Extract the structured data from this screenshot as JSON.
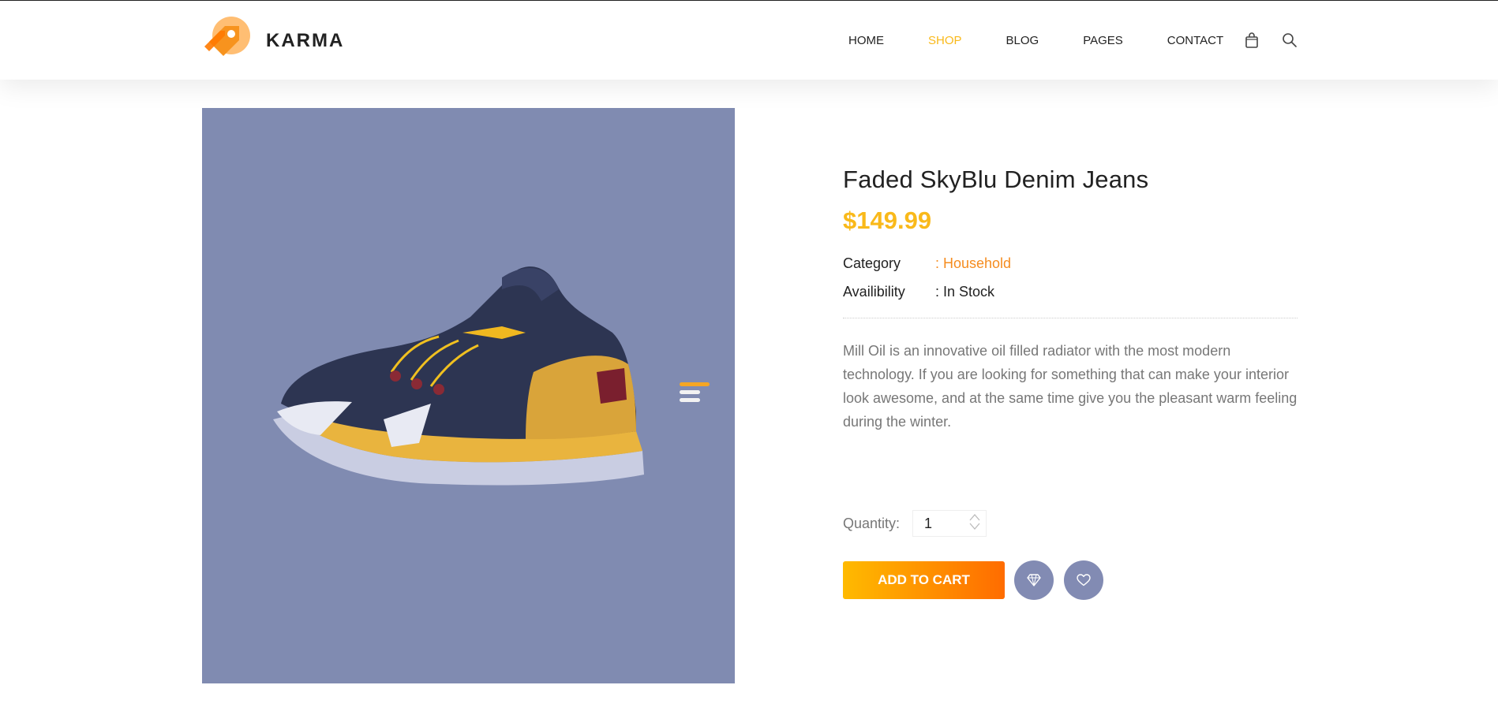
{
  "brand": {
    "name": "KARMA",
    "primary_color": "#f9b91a",
    "accent_orange": "#f58c1f"
  },
  "nav": {
    "items": [
      {
        "label": "HOME",
        "active": false
      },
      {
        "label": "SHOP",
        "active": true
      },
      {
        "label": "BLOG",
        "active": false
      },
      {
        "label": "PAGES",
        "active": false
      },
      {
        "label": "CONTACT",
        "active": false
      }
    ],
    "icons": [
      "shopping-bag-icon",
      "search-icon"
    ]
  },
  "gallery": {
    "background": "#808bb1",
    "image": "basketball-shoe"
  },
  "product": {
    "title": "Faded SkyBlu Denim Jeans",
    "price": "$149.99",
    "category_label": "Category",
    "category_value": ": Household",
    "availability_label": "Availibility",
    "availability_value": ": In Stock",
    "description": "Mill Oil is an innovative oil filled radiator with the most modern technology. If you are looking for something that can make your interior look awesome, and at the same time give you the pleasant warm feeling during the winter."
  },
  "purchase": {
    "quantity_label": "Quantity:",
    "quantity_value": "1",
    "add_to_cart_label": "ADD TO CART",
    "icons": [
      "diamond-icon",
      "heart-icon"
    ]
  }
}
